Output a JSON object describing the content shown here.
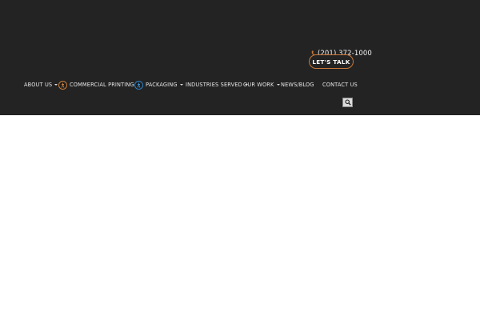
{
  "header": {
    "phone": "(201) 372-1000",
    "cta_label": "LET'S TALK"
  },
  "nav": {
    "items": [
      {
        "label": "ABOUT US",
        "dropdown": true
      },
      {
        "label": "COMMERCIAL PRINTING",
        "dropdown": true,
        "icon": "commercial-printing-icon"
      },
      {
        "label": "PACKAGING",
        "dropdown": true,
        "icon": "packaging-icon"
      },
      {
        "label": "INDUSTRIES SERVED",
        "dropdown": true
      },
      {
        "label": "OUR WORK",
        "dropdown": true
      },
      {
        "label": "NEWS/BLOG",
        "dropdown": false
      },
      {
        "label": "CONTACT US",
        "dropdown": false
      }
    ]
  },
  "icons": {
    "phone": "phone-icon",
    "search": "search-icon"
  },
  "colors": {
    "header_bg": "#232323",
    "accent_orange": "#c9783a",
    "accent_blue": "#2e7fc0"
  }
}
